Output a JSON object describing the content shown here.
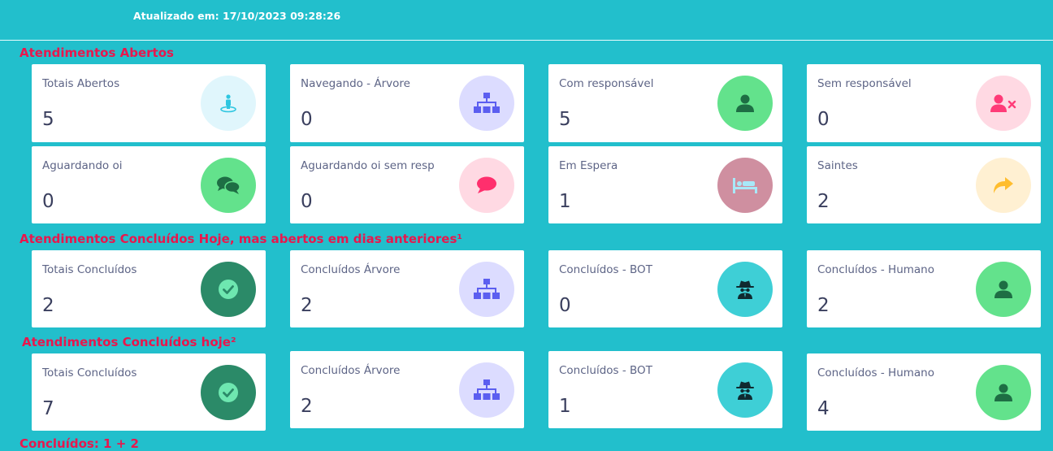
{
  "header": {
    "updated": "Atualizado em: 17/10/2023 09:28:26"
  },
  "sections": {
    "s1": {
      "title": "Atendimentos Abertos"
    },
    "s2": {
      "title": "Atendimentos Concluídos Hoje, mas abertos em dias anteriores¹"
    },
    "s3": {
      "title": "Atendimentos Concluídos hoje²"
    },
    "s4": {
      "title": "Concluídos: 1 + 2"
    }
  },
  "cards": {
    "totais_abertos": {
      "label": "Totais Abertos",
      "value": "5",
      "icon": "person-pin-icon",
      "bg": "#e0f6fc",
      "fg": "#2ec6e0"
    },
    "navegando_arvore": {
      "label": "Navegando - Árvore",
      "value": "0",
      "icon": "sitemap-icon",
      "bg": "#dcdcff",
      "fg": "#5b5ef0"
    },
    "com_responsavel": {
      "label": "Com responsável",
      "value": "5",
      "icon": "user-icon",
      "bg": "#63e28c",
      "fg": "#1e6e44"
    },
    "sem_responsavel": {
      "label": "Sem responsável",
      "value": "0",
      "icon": "user-x-icon",
      "bg": "#ffd9e3",
      "fg": "#ff3b78"
    },
    "aguardando_oi": {
      "label": "Aguardando oi",
      "value": "0",
      "icon": "chat-bubbles-icon",
      "bg": "#63e28c",
      "fg": "#1e6e44"
    },
    "aguardando_oi_sem_resp": {
      "label": "Aguardando oi sem resp",
      "value": "0",
      "icon": "comment-icon",
      "bg": "#ffd9e3",
      "fg": "#ff2f6d"
    },
    "em_espera": {
      "label": "Em Espera",
      "value": "1",
      "icon": "bed-icon",
      "bg": "#cf8fa0",
      "fg": "#a8e8f8"
    },
    "saintes": {
      "label": "Saintes",
      "value": "2",
      "icon": "share-arrow-icon",
      "bg": "#fff0d2",
      "fg": "#ffbd2e"
    },
    "ontem_totais": {
      "label": "Totais Concluídos",
      "value": "2",
      "icon": "check-circle-icon",
      "bg": "#2b8a68",
      "fg": "#6ee7b0"
    },
    "ontem_arvore": {
      "label": "Concluídos Árvore",
      "value": "2",
      "icon": "sitemap-icon",
      "bg": "#dcdcff",
      "fg": "#5b5ef0"
    },
    "ontem_bot": {
      "label": "Concluídos - BOT",
      "value": "0",
      "icon": "spy-icon",
      "bg": "#3ecfd6",
      "fg": "#102a30"
    },
    "ontem_humano": {
      "label": "Concluídos - Humano",
      "value": "2",
      "icon": "user-icon",
      "bg": "#63e28c",
      "fg": "#1e6e44"
    },
    "hoje_totais": {
      "label": "Totais Concluídos",
      "value": "7",
      "icon": "check-circle-icon",
      "bg": "#2b8a68",
      "fg": "#6ee7b0"
    },
    "hoje_arvore": {
      "label": "Concluídos Árvore",
      "value": "2",
      "icon": "sitemap-icon",
      "bg": "#dcdcff",
      "fg": "#5b5ef0"
    },
    "hoje_bot": {
      "label": "Concluídos - BOT",
      "value": "1",
      "icon": "spy-icon",
      "bg": "#3ecfd6",
      "fg": "#102a30"
    },
    "hoje_humano": {
      "label": "Concluídos - Humano",
      "value": "4",
      "icon": "user-icon",
      "bg": "#63e28c",
      "fg": "#1e6e44"
    }
  }
}
